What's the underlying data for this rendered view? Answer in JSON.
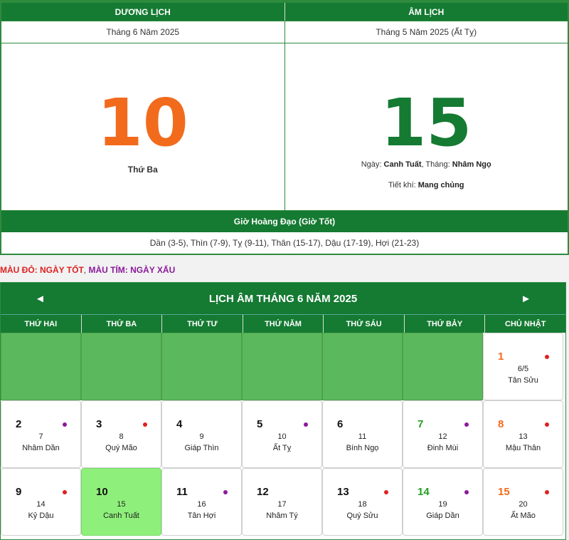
{
  "header": {
    "solar_label": "DƯƠNG LỊCH",
    "lunar_label": "ÂM LỊCH",
    "solar_month": "Tháng 6 Năm 2025",
    "lunar_month": "Tháng 5 Năm 2025 (Ất Tỵ)",
    "solar_day": "10",
    "weekday": "Thứ Ba",
    "lunar_day": "15",
    "ngay_label": "Ngày:",
    "ngay_value": "Canh Tuất",
    "thang_label": ", Tháng:",
    "thang_value": "Nhâm Ngọ",
    "tiet_khi_label": "Tiết khí:",
    "tiet_khi_value": "Mang chủng",
    "gio_hoang_dao_title": "Giờ Hoàng Đạo (Giờ Tốt)",
    "gio_hoang_dao_list": "Dần (3-5), Thìn (7-9), Tỵ (9-11), Thân (15-17), Dậu (17-19), Hợi (21-23)"
  },
  "legend": {
    "good": "MÀU ĐỎ: NGÀY TỐT",
    "separator": ",",
    "bad": "MÀU TÍM: NGÀY XẤU"
  },
  "calendar": {
    "title": "LỊCH ÂM THÁNG 6 NĂM 2025",
    "prev": "◄",
    "next": "►",
    "weekdays": [
      "THỨ HAI",
      "THỨ BA",
      "THỨ TƯ",
      "THỨ NĂM",
      "THỨ SÁU",
      "THỨ BẢY",
      "CHỦ NHẬT"
    ],
    "weeks": [
      [
        {
          "empty": true
        },
        {
          "empty": true
        },
        {
          "empty": true
        },
        {
          "empty": true
        },
        {
          "empty": true
        },
        {
          "empty": true
        },
        {
          "solar": "1",
          "lunar": "6/5",
          "canchi": "Tân Sửu",
          "dot": "good"
        }
      ],
      [
        {
          "solar": "2",
          "lunar": "7",
          "canchi": "Nhâm Dần",
          "dot": "bad"
        },
        {
          "solar": "3",
          "lunar": "8",
          "canchi": "Quý Mão",
          "dot": "good"
        },
        {
          "solar": "4",
          "lunar": "9",
          "canchi": "Giáp Thìn",
          "dot": ""
        },
        {
          "solar": "5",
          "lunar": "10",
          "canchi": "Ất Tỵ",
          "dot": "bad"
        },
        {
          "solar": "6",
          "lunar": "11",
          "canchi": "Bính Ngọ",
          "dot": ""
        },
        {
          "solar": "7",
          "lunar": "12",
          "canchi": "Đinh Mùi",
          "dot": "bad"
        },
        {
          "solar": "8",
          "lunar": "13",
          "canchi": "Mậu Thân",
          "dot": "good"
        }
      ],
      [
        {
          "solar": "9",
          "lunar": "14",
          "canchi": "Kỷ Dậu",
          "dot": "good"
        },
        {
          "solar": "10",
          "lunar": "15",
          "canchi": "Canh Tuất",
          "dot": "",
          "today": true
        },
        {
          "solar": "11",
          "lunar": "16",
          "canchi": "Tân Hợi",
          "dot": "bad"
        },
        {
          "solar": "12",
          "lunar": "17",
          "canchi": "Nhâm Tý",
          "dot": ""
        },
        {
          "solar": "13",
          "lunar": "18",
          "canchi": "Quý Sửu",
          "dot": "good"
        },
        {
          "solar": "14",
          "lunar": "19",
          "canchi": "Giáp Dần",
          "dot": "bad"
        },
        {
          "solar": "15",
          "lunar": "20",
          "canchi": "Ất Mão",
          "dot": "good"
        }
      ]
    ]
  },
  "colors": {
    "header_green": "#157a32",
    "empty_cell_green": "#5cb85c",
    "today_highlight": "#8ef07a",
    "solar_big_orange": "#f26b1d",
    "good_day_red": "#e02020",
    "bad_day_purple": "#8b1a9a"
  }
}
